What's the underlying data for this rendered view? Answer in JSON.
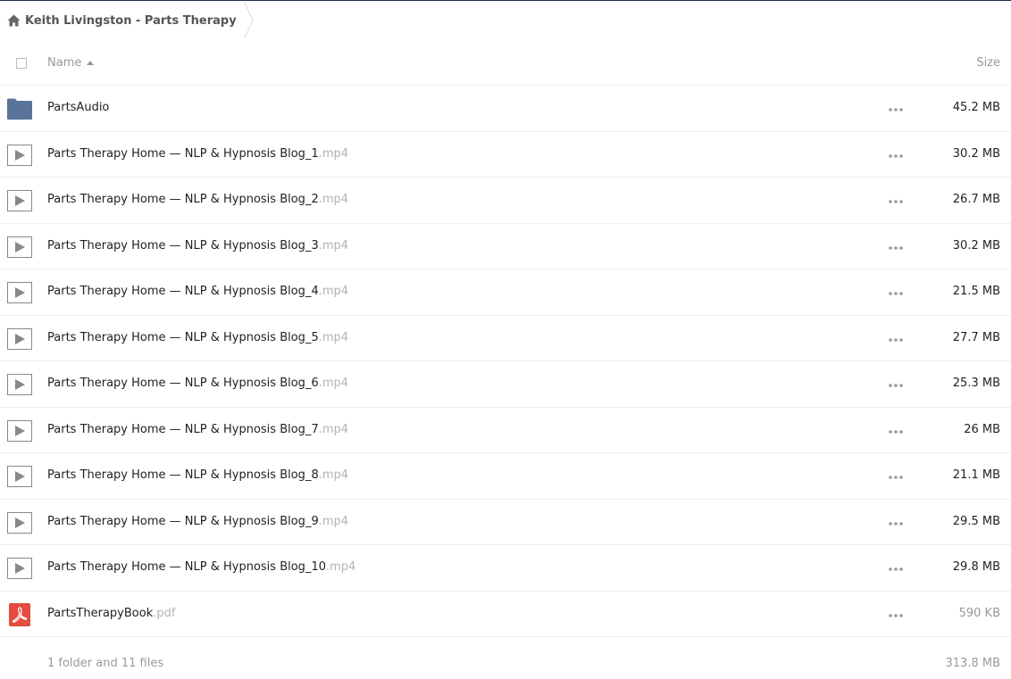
{
  "breadcrumb": {
    "label": "Keith Livingston - Parts Therapy",
    "home_icon": "home-icon"
  },
  "header": {
    "name_label": "Name",
    "size_label": "Size",
    "sort_icon": "sort-ascending-icon"
  },
  "files": [
    {
      "type": "folder",
      "base": "PartsAudio",
      "ext": "",
      "size": "45.2 MB",
      "icon": "folder-icon"
    },
    {
      "type": "video",
      "base": "Parts Therapy Home — NLP & Hypnosis Blog_1",
      "ext": ".mp4",
      "size": "30.2 MB",
      "icon": "video-play-icon"
    },
    {
      "type": "video",
      "base": "Parts Therapy Home — NLP & Hypnosis Blog_2",
      "ext": ".mp4",
      "size": "26.7 MB",
      "icon": "video-play-icon"
    },
    {
      "type": "video",
      "base": "Parts Therapy Home — NLP & Hypnosis Blog_3",
      "ext": ".mp4",
      "size": "30.2 MB",
      "icon": "video-play-icon"
    },
    {
      "type": "video",
      "base": "Parts Therapy Home — NLP & Hypnosis Blog_4",
      "ext": ".mp4",
      "size": "21.5 MB",
      "icon": "video-play-icon"
    },
    {
      "type": "video",
      "base": "Parts Therapy Home — NLP & Hypnosis Blog_5",
      "ext": ".mp4",
      "size": "27.7 MB",
      "icon": "video-play-icon"
    },
    {
      "type": "video",
      "base": "Parts Therapy Home — NLP & Hypnosis Blog_6",
      "ext": ".mp4",
      "size": "25.3 MB",
      "icon": "video-play-icon"
    },
    {
      "type": "video",
      "base": "Parts Therapy Home — NLP & Hypnosis Blog_7",
      "ext": ".mp4",
      "size": "26 MB",
      "icon": "video-play-icon"
    },
    {
      "type": "video",
      "base": "Parts Therapy Home — NLP & Hypnosis Blog_8",
      "ext": ".mp4",
      "size": "21.1 MB",
      "icon": "video-play-icon"
    },
    {
      "type": "video",
      "base": "Parts Therapy Home — NLP & Hypnosis Blog_9",
      "ext": ".mp4",
      "size": "29.5 MB",
      "icon": "video-play-icon"
    },
    {
      "type": "video",
      "base": "Parts Therapy Home — NLP & Hypnosis Blog_10",
      "ext": ".mp4",
      "size": "29.8 MB",
      "icon": "video-play-icon"
    },
    {
      "type": "pdf",
      "base": "PartsTherapyBook",
      "ext": ".pdf",
      "size": "590 KB",
      "icon": "pdf-icon",
      "size_muted": true
    }
  ],
  "summary": {
    "info": "1 folder and 11 files",
    "total": "313.8 MB"
  },
  "colors": {
    "folder": "#5a7499",
    "pdf": "#e34c3f",
    "muted_text": "#999999",
    "border": "#eeeeee"
  }
}
